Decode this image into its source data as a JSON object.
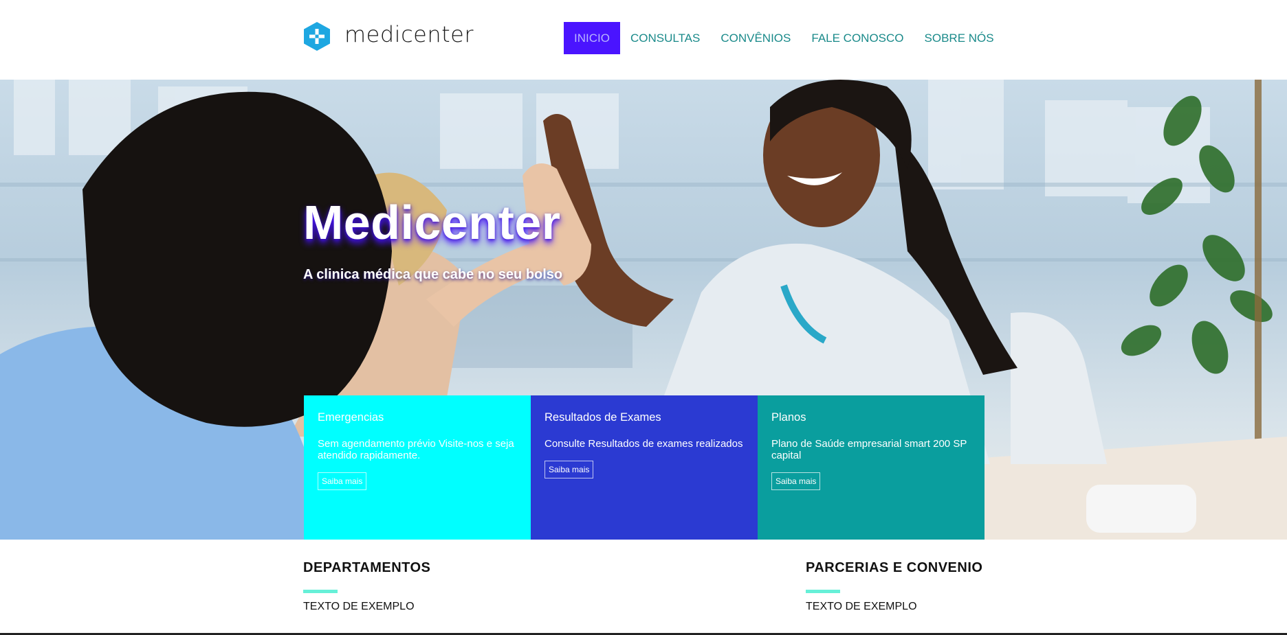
{
  "brand": {
    "name": "medicenter",
    "icon": "hexagon-plus-icon",
    "color": "#1ea7e1"
  },
  "nav": {
    "items": [
      {
        "label": "INICIO",
        "active": true
      },
      {
        "label": "CONSULTAS",
        "active": false
      },
      {
        "label": "CONVÊNIOS",
        "active": false
      },
      {
        "label": "FALE CONOSCO",
        "active": false
      },
      {
        "label": "SOBRE NÓS",
        "active": false
      }
    ],
    "active_bg": "#4a14ff",
    "link_color": "#1a8a8a"
  },
  "hero": {
    "title": "Medicenter",
    "subtitle": "A clinica médica que cabe no seu bolso"
  },
  "cards": [
    {
      "title": "Emergencias",
      "text": "Sem agendamento prévio Visite-nos e seja atendido rapidamente.",
      "button": "Saiba mais",
      "color": "#00ffff"
    },
    {
      "title": "Resultados de Exames",
      "text": "Consulte Resultados de exames realizados",
      "button": "Saiba mais",
      "color": "#2b3ad2"
    },
    {
      "title": "Planos",
      "text": "Plano de Saúde empresarial smart 200 SP capital",
      "button": "Saiba mais",
      "color": "#0a9e9e"
    }
  ],
  "sections": {
    "departamentos": {
      "title": "DEPARTAMENTOS",
      "text": "TEXTO DE EXEMPLO"
    },
    "parcerias": {
      "title": "PARCERIAS E CONVENIO",
      "text": "TEXTO DE EXEMPLO"
    },
    "accent": "#66f0d8"
  }
}
